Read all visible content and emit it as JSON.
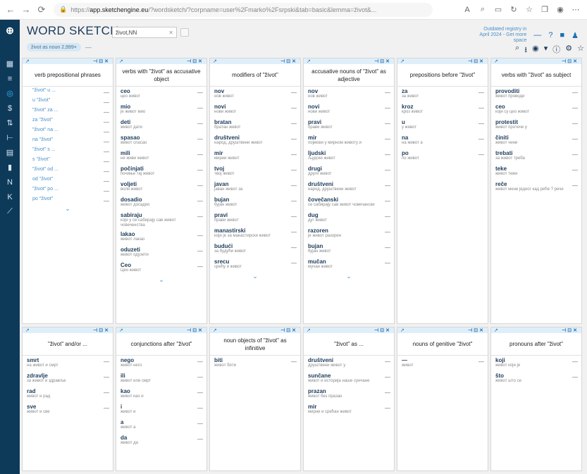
{
  "browser": {
    "url_prefix": "https://",
    "url_host": "app.sketchengine.eu",
    "url_rest": "/?wordsketch/?corpname=user%2Fmarko%2Fsrpski&tab=basic&lemma=život&..."
  },
  "app": {
    "title": "WORD SKETCH",
    "search_value": "život,NN",
    "subtitle_chip": "život as noun 2,999×",
    "notice": "Outdated registry in April 2024 - Get more space",
    "sidebar_icons": [
      "dashboard-icon",
      "list-icon",
      "target-icon",
      "dollar-icon",
      "sort-icon",
      "compare-icon",
      "concordance-icon",
      "bars-icon",
      "ngram-icon",
      "keywords-icon",
      "chart-icon"
    ]
  },
  "columns_top": [
    {
      "header": "verb prepositional phrases",
      "rows": [
        {
          "w": "\"život\" u ...",
          "ex": "",
          "link": true
        },
        {
          "w": "u \"život\"",
          "ex": "",
          "link": true
        },
        {
          "w": "\"život\" za ...",
          "ex": "",
          "link": true
        },
        {
          "w": "za \"život\"",
          "ex": "",
          "link": true
        },
        {
          "w": "\"život\" na ...",
          "ex": "",
          "link": true
        },
        {
          "w": "na \"život\"",
          "ex": "",
          "link": true
        },
        {
          "w": "\"život\" s ...",
          "ex": "",
          "link": true
        },
        {
          "w": "s \"život\"",
          "ex": "",
          "link": true
        },
        {
          "w": "\"život\" od ...",
          "ex": "",
          "link": true
        },
        {
          "w": "od \"život\"",
          "ex": "",
          "link": true
        },
        {
          "w": "\"život\" po ...",
          "ex": "",
          "link": true
        },
        {
          "w": "po \"život\"",
          "ex": "",
          "link": true
        }
      ],
      "more": true
    },
    {
      "header": "verbs with \"život\" as accusative object",
      "rows": [
        {
          "w": "ceo",
          "ex": "цео живот"
        },
        {
          "w": "mio",
          "ex": "је живот мио"
        },
        {
          "w": "deti",
          "ex": "живот дати"
        },
        {
          "w": "spasao",
          "ex": "живот спасао"
        },
        {
          "w": "mili",
          "ex": "не живи живот"
        },
        {
          "w": "počinjati",
          "ex": "почиње тај живот"
        },
        {
          "w": "voljeti",
          "ex": "волн живот"
        },
        {
          "w": "dosadio",
          "ex": "живот досадио"
        },
        {
          "w": "sabiraju",
          "ex": "које у се сабирају сав живот човеченства"
        },
        {
          "w": "lakao",
          "ex": "живот лакао"
        },
        {
          "w": "oduzeti",
          "ex": "живот одузети"
        },
        {
          "w": "Ceo",
          "ex": "Цео живот"
        }
      ],
      "more": true
    },
    {
      "header": "modifiers of \"život\"",
      "rows": [
        {
          "w": "nov",
          "ex": "нов живот"
        },
        {
          "w": "novi",
          "ex": "нови живот"
        },
        {
          "w": "bratan",
          "ex": "братан живот"
        },
        {
          "w": "društveni",
          "ex": "народ, друштвени живот"
        },
        {
          "w": "mir",
          "ex": "мирни живот"
        },
        {
          "w": "tvoj",
          "ex": "твој живот"
        },
        {
          "w": "javan",
          "ex": "јаван живот за"
        },
        {
          "w": "bujan",
          "ex": "бујан живот"
        },
        {
          "w": "pravi",
          "ex": "прави живот"
        },
        {
          "w": "manastirski",
          "ex": "који је за манастирски живот"
        },
        {
          "w": "budući",
          "ex": "за будући живот"
        },
        {
          "w": "srecu",
          "ex": "срећу и живот"
        }
      ],
      "more": true
    },
    {
      "header": "accusative nouns of \"život\" as adjective",
      "rows": [
        {
          "w": "nov",
          "ex": "нов живот"
        },
        {
          "w": "novi",
          "ex": "нови живот"
        },
        {
          "w": "pravi",
          "ex": "прави живот"
        },
        {
          "w": "mir",
          "ex": "појмови у мирном животу и"
        },
        {
          "w": "ljudski",
          "ex": "људски живот"
        },
        {
          "w": "drugi",
          "ex": "други живот"
        },
        {
          "w": "društveni",
          "ex": "народ, друштвени живот"
        },
        {
          "w": "čovečanski",
          "ex": "се сабирају сав живот човечански"
        },
        {
          "w": "dug",
          "ex": "дуг живот"
        },
        {
          "w": "razoren",
          "ex": "је живот разорен"
        },
        {
          "w": "bujan",
          "ex": "бујан живот"
        },
        {
          "w": "mučan",
          "ex": "мучан живот"
        }
      ],
      "more": true
    },
    {
      "header": "prepositions before \"život\"",
      "rows": [
        {
          "w": "za",
          "ex": "за живот"
        },
        {
          "w": "kroz",
          "ex": "кроз живот"
        },
        {
          "w": "u",
          "ex": "у живот"
        },
        {
          "w": "na",
          "ex": "на живот а"
        },
        {
          "w": "po",
          "ex": "по живот"
        }
      ],
      "more": false
    },
    {
      "header": "verbs with \"život\" as subject",
      "rows": [
        {
          "w": "provoditi",
          "ex": "живот проводи"
        },
        {
          "w": "ceo",
          "ex": "који су цео живот"
        },
        {
          "w": "protestit",
          "ex": "живот протече у"
        },
        {
          "w": "činiti",
          "ex": "живот чини"
        },
        {
          "w": "trebati",
          "ex": "за живот треба"
        },
        {
          "w": "teke",
          "ex": "живот теже"
        },
        {
          "w": "reče",
          "ex": "живот мени једног кад реће ? рече"
        }
      ],
      "more": false
    }
  ],
  "columns_bottom": [
    {
      "header": "\"život\" and/or ...",
      "rows": [
        {
          "w": "smrt",
          "ex": "на живот и смрт"
        },
        {
          "w": "zdravlje",
          "ex": "за живот и здравље"
        },
        {
          "w": "rad",
          "ex": "живот и рад"
        },
        {
          "w": "sve",
          "ex": "живот и све"
        }
      ]
    },
    {
      "header": "conjunctions after \"život\"",
      "rows": [
        {
          "w": "nego",
          "ex": "живот него"
        },
        {
          "w": "ili",
          "ex": "живот или смрт"
        },
        {
          "w": "kao",
          "ex": "живот као и"
        },
        {
          "w": "i",
          "ex": "живот и"
        },
        {
          "w": "a",
          "ex": "живот а"
        },
        {
          "w": "da",
          "ex": "живот да"
        }
      ]
    },
    {
      "header": "noun objects of \"život\" as infinitive",
      "rows": [
        {
          "w": "biti",
          "ex": "живот бити"
        }
      ]
    },
    {
      "header": "\"život\" as ...",
      "rows": [
        {
          "w": "društveni",
          "ex": "друштвени живот у"
        },
        {
          "w": "sunčane",
          "ex": "живот и историја наше сунчане"
        },
        {
          "w": "prazan",
          "ex": "живот без празан"
        },
        {
          "w": "mir",
          "ex": "мирни и срећан живот"
        }
      ]
    },
    {
      "header": "nouns of genitive \"život\"",
      "rows": [
        {
          "w": "—",
          "ex": "живот"
        }
      ]
    },
    {
      "header": "pronouns after \"život\"",
      "rows": [
        {
          "w": "koji",
          "ex": "живот који је"
        },
        {
          "w": "što",
          "ex": "живот што се"
        }
      ]
    }
  ]
}
